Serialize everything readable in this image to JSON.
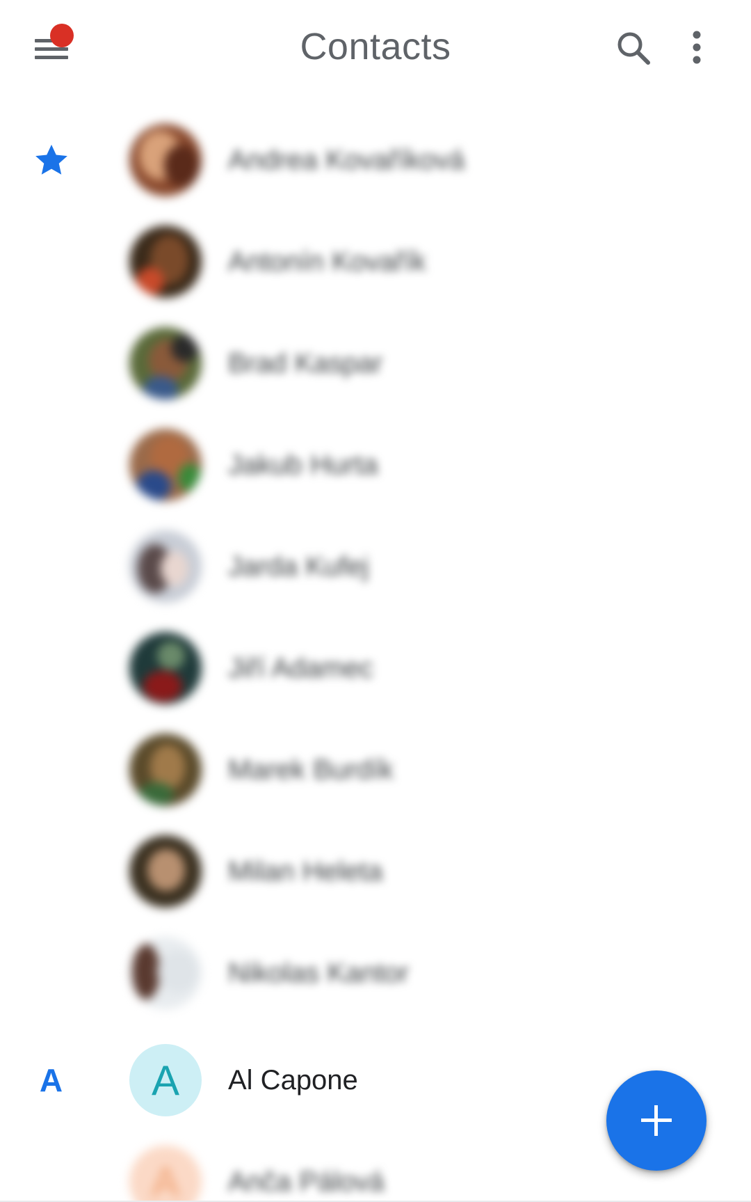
{
  "appbar": {
    "title": "Contacts",
    "menu_icon": "hamburger-menu-icon",
    "search_icon": "search-icon",
    "more_icon": "more-vert-icon",
    "notification_color": "#d93025"
  },
  "sections": {
    "favorites_icon": "star-icon",
    "letter_a": "A"
  },
  "contacts": [
    {
      "name": "Andrea Kovaříková",
      "blurred": true
    },
    {
      "name": "Antonín Kovařík",
      "blurred": true
    },
    {
      "name": "Brad Kaspar",
      "blurred": true
    },
    {
      "name": "Jakub Hurta",
      "blurred": true
    },
    {
      "name": "Jarda Kufej",
      "blurred": true
    },
    {
      "name": "Jiří Adamec",
      "blurred": true
    },
    {
      "name": "Marek Burdík",
      "blurred": true
    },
    {
      "name": "Milan Heleta",
      "blurred": true
    },
    {
      "name": "Nikolas Kantor",
      "blurred": true
    },
    {
      "name": "Al Capone",
      "blurred": false,
      "initial": "A"
    },
    {
      "name": "Anča Pálová",
      "blurred": true,
      "initial": "A"
    }
  ],
  "fab": {
    "icon": "add-icon",
    "color": "#1a73e8"
  },
  "colors": {
    "accent": "#1a73e8",
    "icon_gray": "#5f6368",
    "text": "#202124",
    "initial_avatar_bg": "#cdeff5",
    "initial_avatar_fg": "#1aa3b0"
  }
}
